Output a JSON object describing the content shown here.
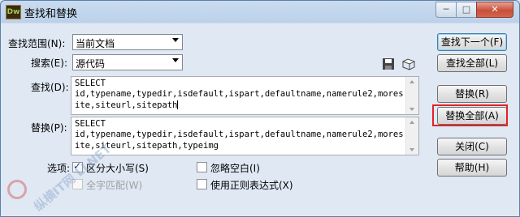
{
  "window": {
    "app_icon_text": "Dw",
    "title": "查找和替换",
    "min_glyph": "─",
    "max_glyph": "□",
    "close_glyph": "✕"
  },
  "form": {
    "scope_label": "查找范围(N):",
    "scope_value": "当前文档",
    "search_label": "搜索(E):",
    "search_value": "源代码",
    "find_label": "查找(D):",
    "find_text": "SELECT\nid,typename,typedir,isdefault,ispart,defaultname,namerule2,moresite,siteurl,sitepath",
    "replace_label": "替换(P):",
    "replace_text": "SELECT\nid,typename,typedir,isdefault,ispart,defaultname,namerule2,moresite,siteurl,sitepath,typeimg",
    "options_label": "选项:"
  },
  "options": {
    "match_case": {
      "label": "区分大小写(S)",
      "checked": true
    },
    "ignore_whitespace": {
      "label": "忽略空白(I)",
      "checked": false
    },
    "whole_word": {
      "label": "全字匹配(W)",
      "checked": false,
      "disabled": true
    },
    "use_regex": {
      "label": "使用正则表达式(X)",
      "checked": false
    }
  },
  "buttons": {
    "find_next": "查找下一个(F)",
    "find_all": "查找全部(L)",
    "replace": "替换(R)",
    "replace_all": "替换全部(A)",
    "close": "关闭(C)",
    "help": "帮助(H)"
  },
  "watermark": {
    "text": "纵横IT网 LLNET"
  },
  "colors": {
    "highlight_border": "#e0232a",
    "dialog_background": "#dfe8f3",
    "close_button": "#c7503b"
  },
  "icons": {
    "save_query": "floppy-disk-icon",
    "load_query": "open-folder-icon"
  }
}
